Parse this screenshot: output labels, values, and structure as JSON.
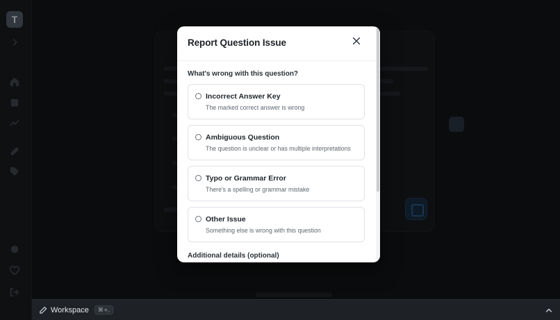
{
  "app": {
    "logo_letter": "T"
  },
  "sidebar": {
    "icons": [
      "chevron-right-icon",
      "home-icon",
      "book-icon",
      "chart-icon",
      "pencil-icon",
      "tag-icon",
      "settings-icon",
      "heart-icon",
      "logout-icon"
    ]
  },
  "workspace_bar": {
    "label": "Workspace",
    "shortcut": "⌘+,"
  },
  "modal": {
    "title": "Report Question Issue",
    "question": "What's wrong with this question?",
    "options": [
      {
        "title": "Incorrect Answer Key",
        "description": "The marked correct answer is wrong"
      },
      {
        "title": "Ambiguous Question",
        "description": "The question is unclear or has multiple interpretations"
      },
      {
        "title": "Typo or Grammar Error",
        "description": "There's a spelling or grammar mistake"
      },
      {
        "title": "Other Issue",
        "description": "Something else is wrong with this question"
      }
    ],
    "details_label": "Additional details (optional)"
  }
}
